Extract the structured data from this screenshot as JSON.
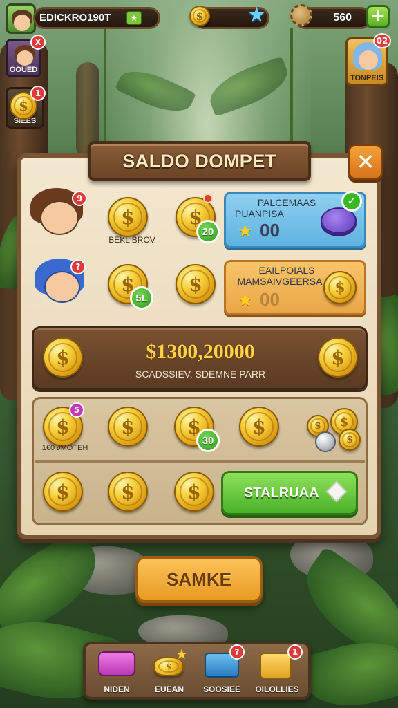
{
  "top_bar": {
    "player_name": "EDICKRO190T",
    "currency_amount": "560",
    "add_label": "+"
  },
  "left_side": {
    "friend_label": "OOUED",
    "friend_badge": "X",
    "coins_label": "SIEES",
    "coins_badge": "1"
  },
  "right_side": {
    "hero_label": "TONPEIS",
    "hero_badge": "02"
  },
  "panel": {
    "title": "SALDO DOMPET",
    "close_symbol": "✕",
    "row1": {
      "char_badge": "9",
      "caption": "BEKL BROV",
      "coin_badge": "20",
      "card_line1": "PALCEMAAS",
      "card_line2": "PUANPISA",
      "card_value": "00"
    },
    "row2": {
      "char_badge": "?",
      "coin_badge": "5L",
      "card_line1": "EAILPOIALS",
      "card_line2": "MAMSAIVGEERSA",
      "card_value": "00"
    },
    "balance": {
      "amount": "$1300,20000",
      "subtitle": "SCADSSIEV, SDEMNE PARR"
    },
    "grid": {
      "row1_badge": "5",
      "row1_caption": "1€0 ∂MOTEH",
      "row1_coin_badge": "30",
      "start_label": "STALRUAA"
    }
  },
  "save_button": "SAMKE",
  "bottom_nav": [
    {
      "label": "NIDEN"
    },
    {
      "label": "EUEAN"
    },
    {
      "label": "SOOSIEE",
      "badge": "?"
    },
    {
      "label": "OILOLLIES",
      "badge": "1"
    }
  ],
  "colors": {
    "panel_bg": "#f3e7cf",
    "wood": "#7a5433",
    "gold": "#f7cf3a",
    "green_button": "#4ab22a",
    "orange_button": "#e89a22",
    "blue_card": "#8fd0f0",
    "orange_card": "#f8c46a"
  }
}
